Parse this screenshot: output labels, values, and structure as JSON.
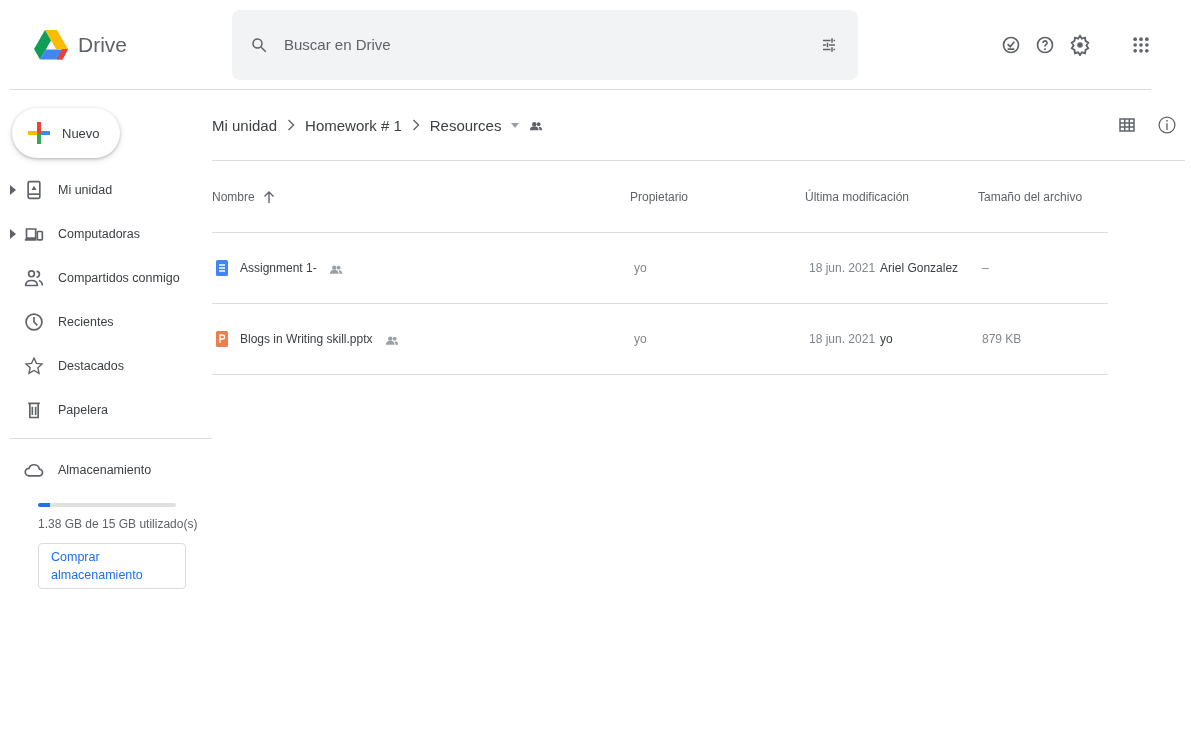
{
  "app": {
    "name": "Drive"
  },
  "search": {
    "placeholder": "Buscar en Drive"
  },
  "new_button": {
    "label": "Nuevo"
  },
  "sidebar": {
    "items": [
      {
        "kind": "drive",
        "label": "Mi unidad",
        "expandable": true
      },
      {
        "kind": "computers",
        "label": "Computadoras",
        "expandable": true
      },
      {
        "kind": "shared",
        "label": "Compartidos conmigo",
        "expandable": false
      },
      {
        "kind": "recent",
        "label": "Recientes",
        "expandable": false
      },
      {
        "kind": "starred",
        "label": "Destacados",
        "expandable": false
      },
      {
        "kind": "trash",
        "label": "Papelera",
        "expandable": false
      }
    ]
  },
  "storage": {
    "label": "Almacenamiento",
    "level": 0.09,
    "usage": "1.38 GB de 15 GB utilizado(s)",
    "buy_button": "Comprar almacenamiento"
  },
  "breadcrumb": [
    {
      "label": "Mi unidad"
    },
    {
      "label": "Homework # 1"
    },
    {
      "label": "Resources",
      "dropdown": true,
      "shared": true
    }
  ],
  "table": {
    "columns": [
      {
        "label": "Nombre",
        "sorted": true
      },
      {
        "label": "Propietario",
        "sorted": false
      },
      {
        "label": "Última modificación",
        "sorted": false
      },
      {
        "label": "Tamaño del archivo",
        "sorted": false
      }
    ],
    "rows": [
      {
        "kind": "doc",
        "name": "Assignment 1-",
        "shared": true,
        "owner": "yo",
        "modified": "18 jun. 2021",
        "modified_by": "Ariel Gonzalez",
        "size": "–"
      },
      {
        "kind": "slides",
        "name": "Blogs in Writing skill.pptx",
        "shared": true,
        "owner": "yo",
        "modified": "18 jun. 2021",
        "modified_by": "yo",
        "size": "879 KB"
      }
    ]
  }
}
